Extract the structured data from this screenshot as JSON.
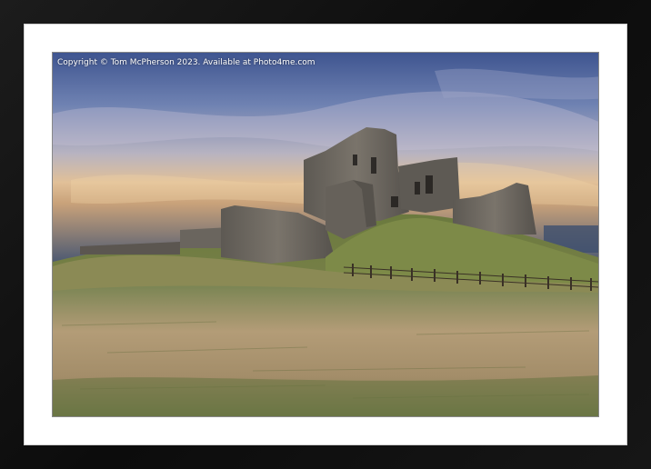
{
  "photo": {
    "copyright": "Copyright © Tom McPherson 2023. Available at Photo4me.com",
    "subject": "castle-ruin-on-grassy-hill"
  },
  "colors": {
    "frame": "#111111",
    "mount": "#ffffff",
    "sky_top": "#4a5f93",
    "sky_horizon": "#e6b681",
    "stone": "#6f6a63",
    "grass": "#a08a62"
  }
}
